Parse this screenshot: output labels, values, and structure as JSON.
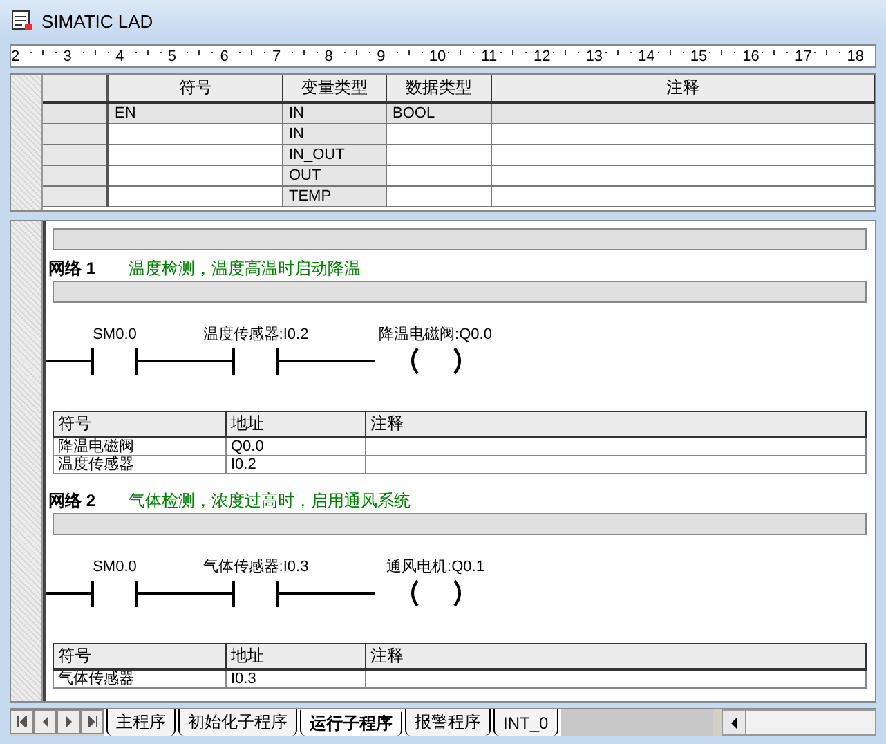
{
  "window": {
    "title": "SIMATIC LAD"
  },
  "ruler": {
    "marks": [
      "2",
      "3",
      "4",
      "5",
      "6",
      "7",
      "8",
      "9",
      "10",
      "11",
      "12",
      "13",
      "14",
      "15",
      "16",
      "17",
      "18"
    ]
  },
  "variable_table": {
    "columns": [
      "符号",
      "变量类型",
      "数据类型",
      "注释"
    ],
    "rows": [
      {
        "symbol": "EN",
        "var_type": "IN",
        "data_type": "BOOL",
        "readonly": true
      },
      {
        "var_type": "IN",
        "readonly": false
      },
      {
        "var_type": "IN_OUT",
        "readonly": false
      },
      {
        "var_type": "OUT",
        "readonly": false
      },
      {
        "var_type": "TEMP",
        "readonly": false
      }
    ]
  },
  "networks": [
    {
      "title": "网络 1",
      "comment": "温度检测，温度高温时启动降温",
      "contacts": [
        "SM0.0",
        "温度传感器:I0.2"
      ],
      "coil": "降温电磁阀:Q0.0",
      "symbol_table": {
        "columns": [
          "符号",
          "地址",
          "注释"
        ],
        "rows": [
          {
            "symbol": "降温电磁阀",
            "address": "Q0.0"
          },
          {
            "symbol": "温度传感器",
            "address": "I0.2"
          }
        ]
      }
    },
    {
      "title": "网络 2",
      "comment": "气体检测，浓度过高时，启用通风系统",
      "contacts": [
        "SM0.0",
        "气体传感器:I0.3"
      ],
      "coil": "通风电机:Q0.1",
      "symbol_table": {
        "columns": [
          "符号",
          "地址",
          "注释"
        ],
        "rows": [
          {
            "symbol": "气体传感器",
            "address": "I0.3"
          }
        ]
      }
    }
  ],
  "tabs": [
    {
      "label": "主程序",
      "selected": false
    },
    {
      "label": "初始化子程序",
      "selected": false
    },
    {
      "label": "运行子程序",
      "selected": true
    },
    {
      "label": "报警程序",
      "selected": false
    },
    {
      "label": "INT_0",
      "selected": false
    }
  ]
}
